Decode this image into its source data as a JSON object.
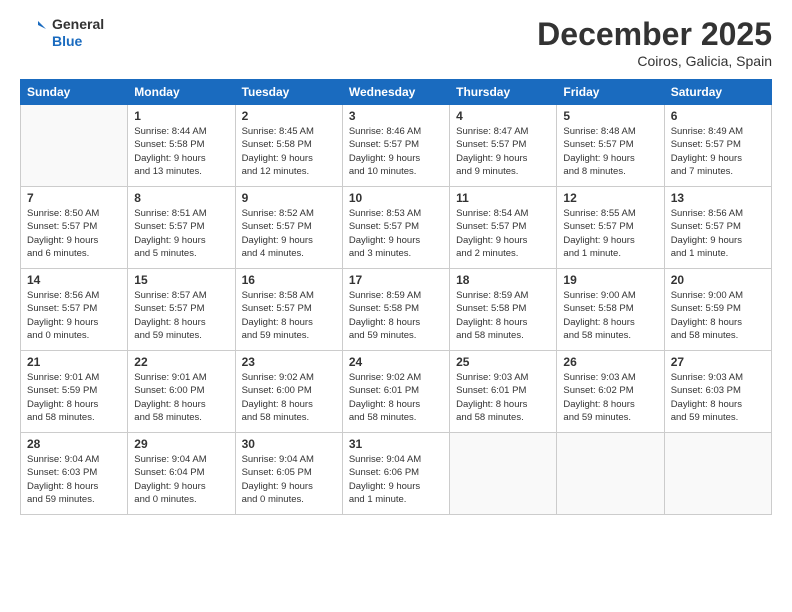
{
  "header": {
    "logo_line1": "General",
    "logo_line2": "Blue",
    "month_year": "December 2025",
    "location": "Coiros, Galicia, Spain"
  },
  "weekdays": [
    "Sunday",
    "Monday",
    "Tuesday",
    "Wednesday",
    "Thursday",
    "Friday",
    "Saturday"
  ],
  "weeks": [
    [
      {
        "day": "",
        "info": ""
      },
      {
        "day": "1",
        "info": "Sunrise: 8:44 AM\nSunset: 5:58 PM\nDaylight: 9 hours\nand 13 minutes."
      },
      {
        "day": "2",
        "info": "Sunrise: 8:45 AM\nSunset: 5:58 PM\nDaylight: 9 hours\nand 12 minutes."
      },
      {
        "day": "3",
        "info": "Sunrise: 8:46 AM\nSunset: 5:57 PM\nDaylight: 9 hours\nand 10 minutes."
      },
      {
        "day": "4",
        "info": "Sunrise: 8:47 AM\nSunset: 5:57 PM\nDaylight: 9 hours\nand 9 minutes."
      },
      {
        "day": "5",
        "info": "Sunrise: 8:48 AM\nSunset: 5:57 PM\nDaylight: 9 hours\nand 8 minutes."
      },
      {
        "day": "6",
        "info": "Sunrise: 8:49 AM\nSunset: 5:57 PM\nDaylight: 9 hours\nand 7 minutes."
      }
    ],
    [
      {
        "day": "7",
        "info": "Sunrise: 8:50 AM\nSunset: 5:57 PM\nDaylight: 9 hours\nand 6 minutes."
      },
      {
        "day": "8",
        "info": "Sunrise: 8:51 AM\nSunset: 5:57 PM\nDaylight: 9 hours\nand 5 minutes."
      },
      {
        "day": "9",
        "info": "Sunrise: 8:52 AM\nSunset: 5:57 PM\nDaylight: 9 hours\nand 4 minutes."
      },
      {
        "day": "10",
        "info": "Sunrise: 8:53 AM\nSunset: 5:57 PM\nDaylight: 9 hours\nand 3 minutes."
      },
      {
        "day": "11",
        "info": "Sunrise: 8:54 AM\nSunset: 5:57 PM\nDaylight: 9 hours\nand 2 minutes."
      },
      {
        "day": "12",
        "info": "Sunrise: 8:55 AM\nSunset: 5:57 PM\nDaylight: 9 hours\nand 1 minute."
      },
      {
        "day": "13",
        "info": "Sunrise: 8:56 AM\nSunset: 5:57 PM\nDaylight: 9 hours\nand 1 minute."
      }
    ],
    [
      {
        "day": "14",
        "info": "Sunrise: 8:56 AM\nSunset: 5:57 PM\nDaylight: 9 hours\nand 0 minutes."
      },
      {
        "day": "15",
        "info": "Sunrise: 8:57 AM\nSunset: 5:57 PM\nDaylight: 8 hours\nand 59 minutes."
      },
      {
        "day": "16",
        "info": "Sunrise: 8:58 AM\nSunset: 5:57 PM\nDaylight: 8 hours\nand 59 minutes."
      },
      {
        "day": "17",
        "info": "Sunrise: 8:59 AM\nSunset: 5:58 PM\nDaylight: 8 hours\nand 59 minutes."
      },
      {
        "day": "18",
        "info": "Sunrise: 8:59 AM\nSunset: 5:58 PM\nDaylight: 8 hours\nand 58 minutes."
      },
      {
        "day": "19",
        "info": "Sunrise: 9:00 AM\nSunset: 5:58 PM\nDaylight: 8 hours\nand 58 minutes."
      },
      {
        "day": "20",
        "info": "Sunrise: 9:00 AM\nSunset: 5:59 PM\nDaylight: 8 hours\nand 58 minutes."
      }
    ],
    [
      {
        "day": "21",
        "info": "Sunrise: 9:01 AM\nSunset: 5:59 PM\nDaylight: 8 hours\nand 58 minutes."
      },
      {
        "day": "22",
        "info": "Sunrise: 9:01 AM\nSunset: 6:00 PM\nDaylight: 8 hours\nand 58 minutes."
      },
      {
        "day": "23",
        "info": "Sunrise: 9:02 AM\nSunset: 6:00 PM\nDaylight: 8 hours\nand 58 minutes."
      },
      {
        "day": "24",
        "info": "Sunrise: 9:02 AM\nSunset: 6:01 PM\nDaylight: 8 hours\nand 58 minutes."
      },
      {
        "day": "25",
        "info": "Sunrise: 9:03 AM\nSunset: 6:01 PM\nDaylight: 8 hours\nand 58 minutes."
      },
      {
        "day": "26",
        "info": "Sunrise: 9:03 AM\nSunset: 6:02 PM\nDaylight: 8 hours\nand 59 minutes."
      },
      {
        "day": "27",
        "info": "Sunrise: 9:03 AM\nSunset: 6:03 PM\nDaylight: 8 hours\nand 59 minutes."
      }
    ],
    [
      {
        "day": "28",
        "info": "Sunrise: 9:04 AM\nSunset: 6:03 PM\nDaylight: 8 hours\nand 59 minutes."
      },
      {
        "day": "29",
        "info": "Sunrise: 9:04 AM\nSunset: 6:04 PM\nDaylight: 9 hours\nand 0 minutes."
      },
      {
        "day": "30",
        "info": "Sunrise: 9:04 AM\nSunset: 6:05 PM\nDaylight: 9 hours\nand 0 minutes."
      },
      {
        "day": "31",
        "info": "Sunrise: 9:04 AM\nSunset: 6:06 PM\nDaylight: 9 hours\nand 1 minute."
      },
      {
        "day": "",
        "info": ""
      },
      {
        "day": "",
        "info": ""
      },
      {
        "day": "",
        "info": ""
      }
    ]
  ]
}
